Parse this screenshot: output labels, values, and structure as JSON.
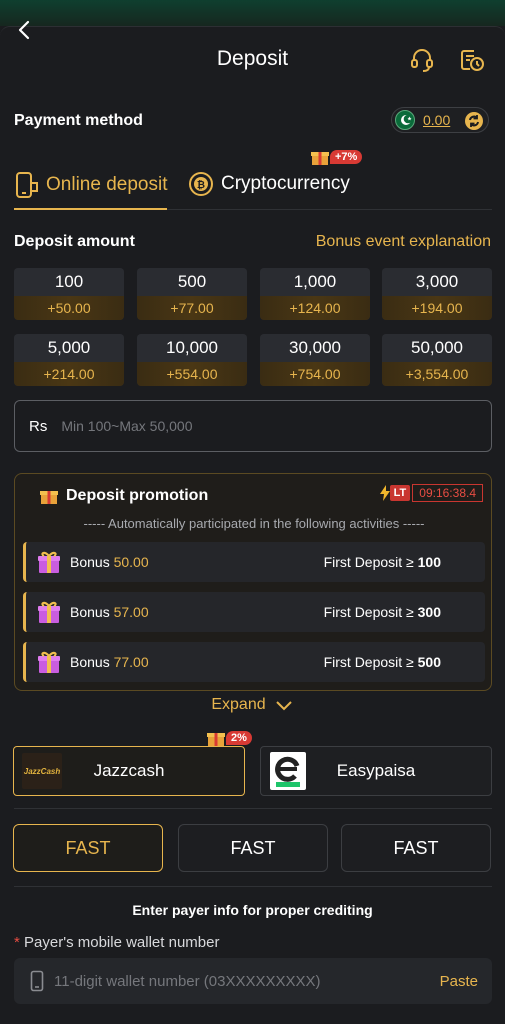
{
  "header": {
    "title": "Deposit",
    "back_icon": "chevron-left-icon",
    "support_icon": "headset-icon",
    "history_icon": "history-icon"
  },
  "payment": {
    "label": "Payment method",
    "balance": "0.00",
    "flag": "pakistan-flag-icon"
  },
  "tabs": [
    {
      "label": "Online deposit",
      "active": true,
      "icon": "phone-icon"
    },
    {
      "label": "Cryptocurrency",
      "active": false,
      "icon": "bitcoin-icon",
      "badge": "+7%"
    }
  ],
  "deposit": {
    "label": "Deposit amount",
    "bonus_link": "Bonus event explanation",
    "amounts": [
      {
        "value": "100",
        "bonus": "+50.00"
      },
      {
        "value": "500",
        "bonus": "+77.00"
      },
      {
        "value": "1,000",
        "bonus": "+124.00"
      },
      {
        "value": "3,000",
        "bonus": "+194.00"
      },
      {
        "value": "5,000",
        "bonus": "+214.00"
      },
      {
        "value": "10,000",
        "bonus": "+554.00"
      },
      {
        "value": "30,000",
        "bonus": "+754.00"
      },
      {
        "value": "50,000",
        "bonus": "+3,554.00"
      }
    ],
    "currency": "Rs",
    "placeholder": "Min 100~Max 50,000"
  },
  "promotion": {
    "title": "Deposit promotion",
    "lt": "LT",
    "timer": "09:16:38.4",
    "note": "----- Automatically participated in the following activities -----",
    "rows": [
      {
        "bonus_label": "Bonus",
        "bonus_value": "50.00",
        "condition": "First Deposit ≥",
        "threshold": "100"
      },
      {
        "bonus_label": "Bonus",
        "bonus_value": "57.00",
        "condition": "First Deposit ≥",
        "threshold": "300"
      },
      {
        "bonus_label": "Bonus",
        "bonus_value": "77.00",
        "condition": "First Deposit ≥",
        "threshold": "500"
      }
    ],
    "expand": "Expand"
  },
  "channels": [
    {
      "name": "Jazzcash",
      "logo_text": "JazzCash",
      "badge": "2%",
      "active": true
    },
    {
      "name": "Easypaisa",
      "active": false
    }
  ],
  "fast": [
    {
      "label": "FAST",
      "active": true
    },
    {
      "label": "FAST",
      "active": false
    },
    {
      "label": "FAST",
      "active": false
    }
  ],
  "payer": {
    "note": "Enter payer info for proper crediting",
    "required_mark": "*",
    "wallet_label": "Payer's mobile wallet number",
    "wallet_placeholder": "11-digit wallet number (03XXXXXXXXX)",
    "paste": "Paste"
  },
  "colors": {
    "accent": "#e7b54e",
    "bg": "#1b1c1f",
    "alert": "#d83a34"
  }
}
